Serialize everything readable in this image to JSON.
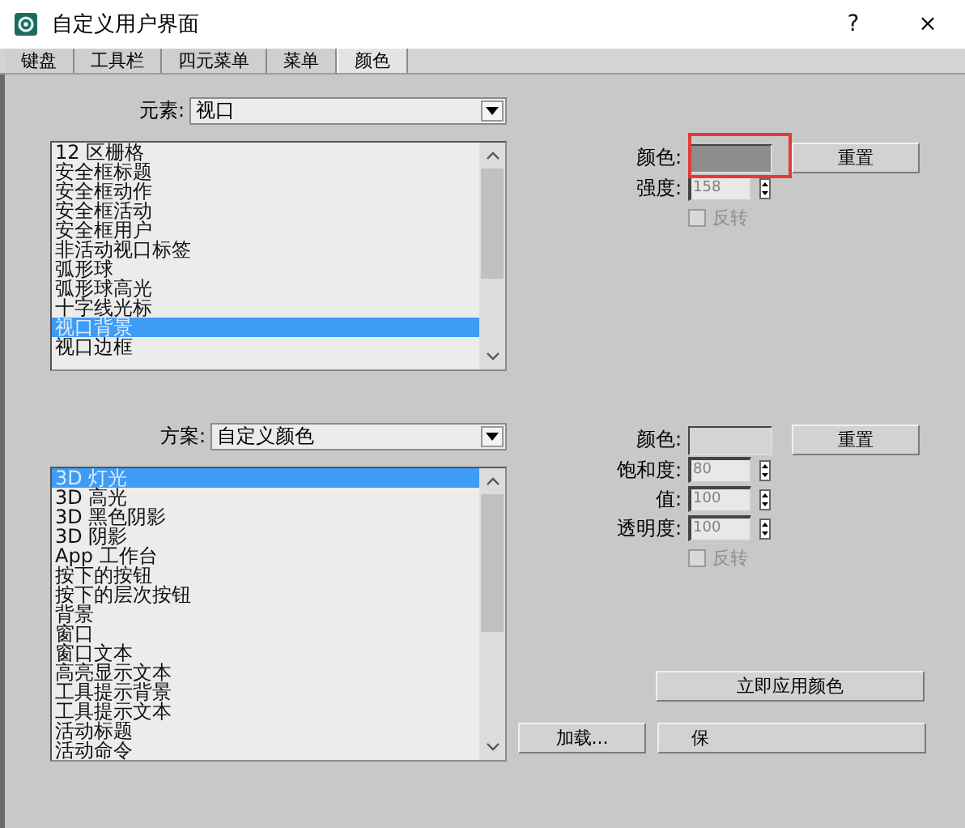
{
  "window": {
    "title": "自定义用户界面",
    "help": "?",
    "close": "×"
  },
  "tabs": [
    {
      "label": "键盘",
      "selected": false
    },
    {
      "label": "工具栏",
      "selected": false
    },
    {
      "label": "四元菜单",
      "selected": false
    },
    {
      "label": "菜单",
      "selected": false
    },
    {
      "label": "颜色",
      "selected": true
    }
  ],
  "element_section": {
    "picker": {
      "label": "元素:",
      "value": "视口"
    },
    "items": [
      {
        "label": "12 区栅格",
        "selected": false
      },
      {
        "label": "安全框标题",
        "selected": false
      },
      {
        "label": "安全框动作",
        "selected": false
      },
      {
        "label": "安全框活动",
        "selected": false
      },
      {
        "label": "安全框用户",
        "selected": false
      },
      {
        "label": "非活动视口标签",
        "selected": false
      },
      {
        "label": "弧形球",
        "selected": false
      },
      {
        "label": "弧形球高光",
        "selected": false
      },
      {
        "label": "十字线光标",
        "selected": false
      },
      {
        "label": "视口背景",
        "selected": true
      },
      {
        "label": "视口边框",
        "selected": false
      }
    ],
    "color": {
      "label": "颜色:",
      "color": "#8e8c8e"
    },
    "reset_button": "重置",
    "fields": [
      {
        "label": "强度:",
        "value": "158",
        "disabled": true
      }
    ],
    "invert": {
      "label": "反转",
      "checked": false,
      "disabled": true
    }
  },
  "scheme_section": {
    "picker": {
      "label": "方案:",
      "value": "自定义颜色"
    },
    "items": [
      {
        "label": "3D 灯光",
        "selected": true
      },
      {
        "label": "3D 高光",
        "selected": false
      },
      {
        "label": "3D 黑色阴影",
        "selected": false
      },
      {
        "label": "3D 阴影",
        "selected": false
      },
      {
        "label": "App 工作台",
        "selected": false
      },
      {
        "label": "按下的按钮",
        "selected": false
      },
      {
        "label": "按下的层次按钮",
        "selected": false
      },
      {
        "label": "背景",
        "selected": false
      },
      {
        "label": "窗口",
        "selected": false
      },
      {
        "label": "窗口文本",
        "selected": false
      },
      {
        "label": "高亮显示文本",
        "selected": false
      },
      {
        "label": "工具提示背景",
        "selected": false
      },
      {
        "label": "工具提示文本",
        "selected": false
      },
      {
        "label": "活动标题",
        "selected": false
      },
      {
        "label": "活动命令",
        "selected": false
      }
    ],
    "color": {
      "label": "颜色:",
      "color": "#d4d4d6"
    },
    "reset_button": "重置",
    "fields": [
      {
        "label": "饱和度:",
        "value": "80",
        "disabled": true
      },
      {
        "label": "值:",
        "value": "100",
        "disabled": true
      },
      {
        "label": "透明度:",
        "value": "100",
        "disabled": true
      }
    ],
    "invert": {
      "label": "反转",
      "checked": false,
      "disabled": true
    }
  },
  "apply_button": "立即应用颜色",
  "load_button": "加载...",
  "save_button": "保"
}
